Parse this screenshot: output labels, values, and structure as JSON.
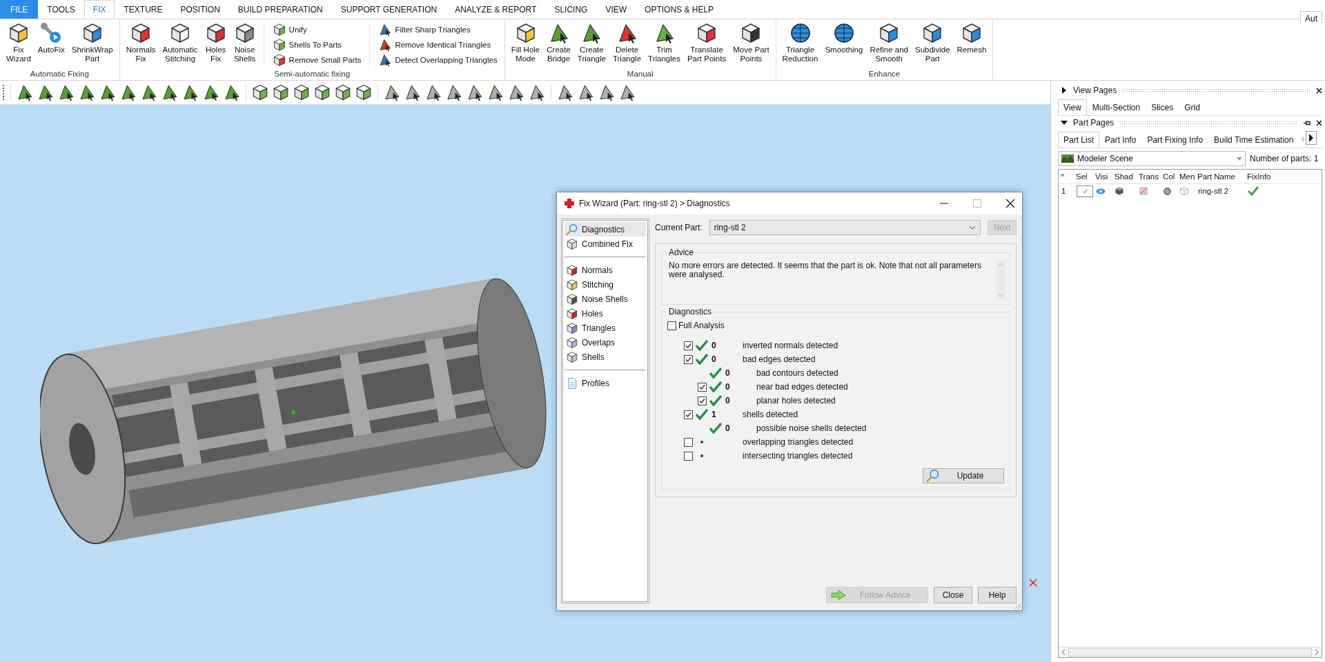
{
  "menu_tabs": [
    {
      "label": "FILE",
      "kind": "file",
      "selected": false
    },
    {
      "label": "TOOLS",
      "kind": "tab",
      "selected": false
    },
    {
      "label": "FIX",
      "kind": "tab",
      "selected": true
    },
    {
      "label": "TEXTURE",
      "kind": "tab",
      "selected": false
    },
    {
      "label": "POSITION",
      "kind": "tab",
      "selected": false
    },
    {
      "label": "BUILD PREPARATION",
      "kind": "tab",
      "selected": false
    },
    {
      "label": "SUPPORT GENERATION",
      "kind": "tab",
      "selected": false
    },
    {
      "label": "ANALYZE & REPORT",
      "kind": "tab",
      "selected": false
    },
    {
      "label": "SLICING",
      "kind": "tab",
      "selected": false
    },
    {
      "label": "VIEW",
      "kind": "tab",
      "selected": false
    },
    {
      "label": "OPTIONS & HELP",
      "kind": "tab",
      "selected": false
    }
  ],
  "corner_tab": "Aut",
  "ribbon_groups": [
    {
      "label": "Automatic Fixing",
      "sections": [
        {
          "kind": "large",
          "tools": [
            "Fix\nWizard",
            "AutoFix",
            "ShrinkWrap\nPart"
          ]
        }
      ]
    },
    {
      "label": "Semi-automatic fixing",
      "sections": [
        {
          "kind": "large",
          "tools": [
            "Normals\nFix",
            "Automatic\nStitching",
            "Holes\nFix",
            "Noise\nShells"
          ]
        },
        {
          "kind": "small",
          "tools": [
            "Unify",
            "Shells To Parts",
            "Remove Small Parts"
          ]
        },
        {
          "kind": "small",
          "tools": [
            "Filter Sharp Triangles",
            "Remove Identical Triangles",
            "Detect Overlapping Triangles"
          ]
        }
      ]
    },
    {
      "label": "Manual",
      "sections": [
        {
          "kind": "large",
          "tools": [
            "Fill Hole\nMode",
            "Create\nBridge",
            "Create\nTriangle",
            "Delete\nTriangle",
            "Trim\nTriangles",
            "Translate\nPart Points",
            "Move Part\nPoints"
          ]
        }
      ]
    },
    {
      "label": "Enhance",
      "sections": [
        {
          "kind": "large",
          "tools": [
            "Triangle\nReduction",
            "Smoothing",
            "Refine and\nSmooth",
            "Subdivide\nPart",
            "Remesh"
          ]
        }
      ]
    }
  ],
  "view_pages": {
    "title": "View Pages",
    "expanded": false,
    "tabs": [
      {
        "label": "View",
        "selected": true
      },
      {
        "label": "Multi-Section",
        "selected": false
      },
      {
        "label": "Slices",
        "selected": false
      },
      {
        "label": "Grid",
        "selected": false
      }
    ]
  },
  "part_pages": {
    "title": "Part Pages",
    "expanded": true,
    "tabs": [
      {
        "label": "Part List",
        "selected": true
      },
      {
        "label": "Part Info",
        "selected": false
      },
      {
        "label": "Part Fixing Info",
        "selected": false
      },
      {
        "label": "Build Time Estimation",
        "selected": false
      }
    ],
    "scene": "Modeler Scene",
    "parts_count": "Number of parts: 1",
    "table": {
      "columns": [
        "^",
        "Sel",
        "Visi",
        "Shad",
        "Trans",
        "Col",
        "Men",
        "Part Name",
        "FixInfo"
      ],
      "rows": [
        {
          "index": "1",
          "checked": true,
          "visible": true,
          "color": "#a0a0a0",
          "name": "ring-stl 2",
          "fixed": true
        }
      ]
    }
  },
  "dialog": {
    "title": "Fix Wizard (Part: ring-stl 2) > Diagnostics",
    "nav_sections": [
      [
        {
          "label": "Diagnostics",
          "selected": true
        },
        {
          "label": "Combined Fix",
          "selected": false
        }
      ],
      [
        {
          "label": "Normals",
          "selected": false
        },
        {
          "label": "Stitching",
          "selected": false
        },
        {
          "label": "Noise Shells",
          "selected": false
        },
        {
          "label": "Holes",
          "selected": false
        },
        {
          "label": "Triangles",
          "selected": false
        },
        {
          "label": "Overlaps",
          "selected": false
        },
        {
          "label": "Shells",
          "selected": false
        }
      ],
      [
        {
          "label": "Profiles",
          "selected": false
        }
      ]
    ],
    "current_part_label": "Current Part:",
    "current_part": "ring-stl 2",
    "next_button": {
      "label": "Next",
      "disabled": true
    },
    "advice": {
      "title": "Advice",
      "text": "No more errors are detected. It seems that the part is ok. Note that not all parameters were analysed."
    },
    "diagnostics": {
      "title": "Diagnostics",
      "full_analysis": {
        "label": "Full Analysis",
        "checked": false
      },
      "items": [
        {
          "label": "inverted normals detected",
          "checked": true,
          "kind": "ok",
          "count": "0"
        },
        {
          "label": "bad edges detected",
          "checked": true,
          "kind": "ok",
          "count": "0",
          "children": [
            {
              "label": "bad contours detected",
              "kind": "ok",
              "count": "0"
            },
            {
              "label": "near bad edges detected",
              "checked": true,
              "kind": "ok",
              "count": "0"
            },
            {
              "label": "planar holes detected",
              "checked": true,
              "kind": "ok",
              "count": "0"
            }
          ]
        },
        {
          "label": "shells detected",
          "checked": true,
          "kind": "ok",
          "count": "1",
          "children": [
            {
              "label": "possible noise shells detected",
              "kind": "ok",
              "count": "0"
            }
          ]
        },
        {
          "label": "overlapping triangles detected",
          "checked": false,
          "kind": "pending"
        },
        {
          "label": "intersecting triangles detected",
          "checked": false,
          "kind": "pending"
        }
      ],
      "update_button": "Update"
    },
    "buttons": [
      {
        "label": "Follow Advice",
        "kind": "advice",
        "disabled": true
      },
      {
        "label": "Close",
        "kind": "plain",
        "disabled": false
      },
      {
        "label": "Help",
        "kind": "plain",
        "disabled": false
      }
    ]
  }
}
